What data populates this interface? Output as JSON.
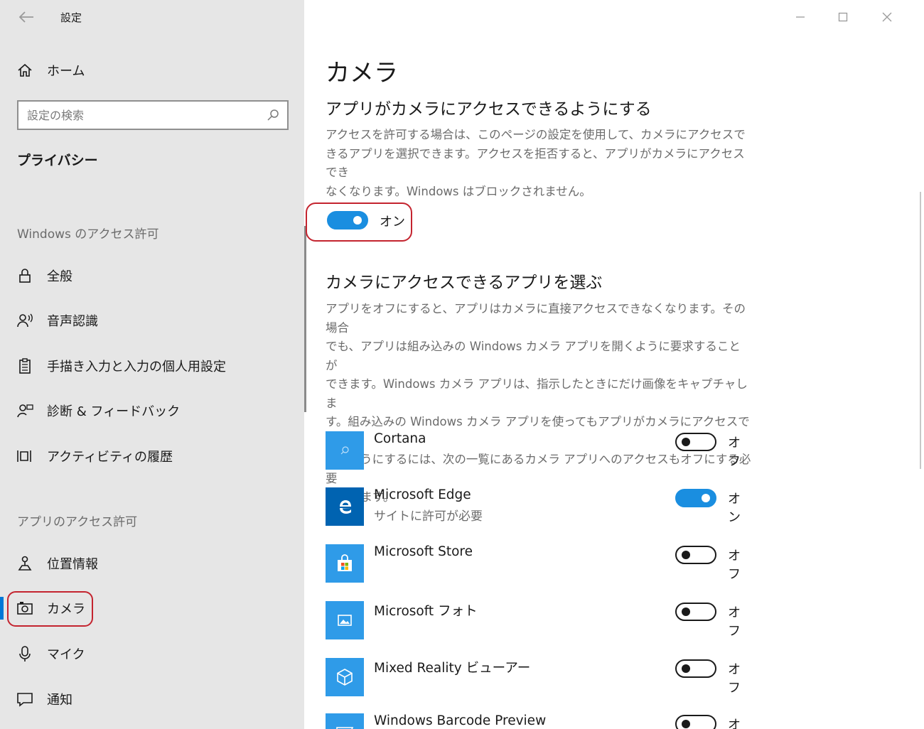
{
  "window": {
    "title": "設定",
    "back_icon": "back-arrow-icon"
  },
  "sidebar": {
    "home_label": "ホーム",
    "search_placeholder": "設定の検索",
    "section_title": "プライバシー",
    "groups": [
      {
        "label": "Windows のアクセス許可",
        "items": [
          {
            "label": "全般",
            "icon": "lock-icon"
          },
          {
            "label": "音声認識",
            "icon": "speech-icon"
          },
          {
            "label": "手描き入力と入力の個人用設定",
            "icon": "clipboard-icon"
          },
          {
            "label": "診断 & フィードバック",
            "icon": "feedback-icon"
          },
          {
            "label": "アクティビティの履歴",
            "icon": "activity-history-icon"
          }
        ]
      },
      {
        "label": "アプリのアクセス許可",
        "items": [
          {
            "label": "位置情報",
            "icon": "location-icon"
          },
          {
            "label": "カメラ",
            "icon": "camera-icon",
            "selected": true
          },
          {
            "label": "マイク",
            "icon": "microphone-icon"
          },
          {
            "label": "通知",
            "icon": "notification-icon"
          }
        ]
      }
    ]
  },
  "main": {
    "title": "カメラ",
    "section1": {
      "heading": "アプリがカメラにアクセスできるようにする",
      "desc_lines": [
        "アクセスを許可する場合は、このページの設定を使用して、カメラにアクセスで",
        "きるアプリを選択できます。アクセスを拒否すると、アプリがカメラにアクセスでき",
        "なくなります。Windows はブロックされません。"
      ],
      "toggle_state": "on",
      "toggle_label": "オン"
    },
    "section2": {
      "heading": "カメラにアクセスできるアプリを選ぶ",
      "desc_lines": [
        "アプリをオフにすると、アプリはカメラに直接アクセスできなくなります。その場合",
        "でも、アプリは組み込みの Windows カメラ アプリを開くように要求することが",
        "できます。Windows カメラ アプリは、指示したときにだけ画像をキャプチャしま",
        "す。組み込みの Windows カメラ アプリを使ってもアプリがカメラにアクセスでき",
        "ないようにするには、次の一覧にあるカメラ アプリへのアクセスもオフにする必要",
        "があります。"
      ]
    },
    "apps": [
      {
        "name": "Cortana",
        "sub": "",
        "state": "off",
        "state_label": "オフ",
        "icon": "cortana-icon"
      },
      {
        "name": "Microsoft Edge",
        "sub": "サイトに許可が必要",
        "state": "on",
        "state_label": "オン",
        "icon": "edge-icon"
      },
      {
        "name": "Microsoft Store",
        "sub": "",
        "state": "off",
        "state_label": "オフ",
        "icon": "store-icon"
      },
      {
        "name": "Microsoft フォト",
        "sub": "",
        "state": "off",
        "state_label": "オフ",
        "icon": "photos-icon"
      },
      {
        "name": "Mixed Reality ビューアー",
        "sub": "",
        "state": "off",
        "state_label": "オフ",
        "icon": "mixed-reality-icon"
      },
      {
        "name": "Windows Barcode Preview",
        "sub": "",
        "state": "off",
        "state_label": "オフ",
        "icon": "barcode-icon"
      }
    ]
  },
  "colors": {
    "accent": "#0078d7",
    "toggle_on": "#1a8ee0",
    "highlight": "#c4242f",
    "sidebar_bg": "#e6e6e6"
  }
}
